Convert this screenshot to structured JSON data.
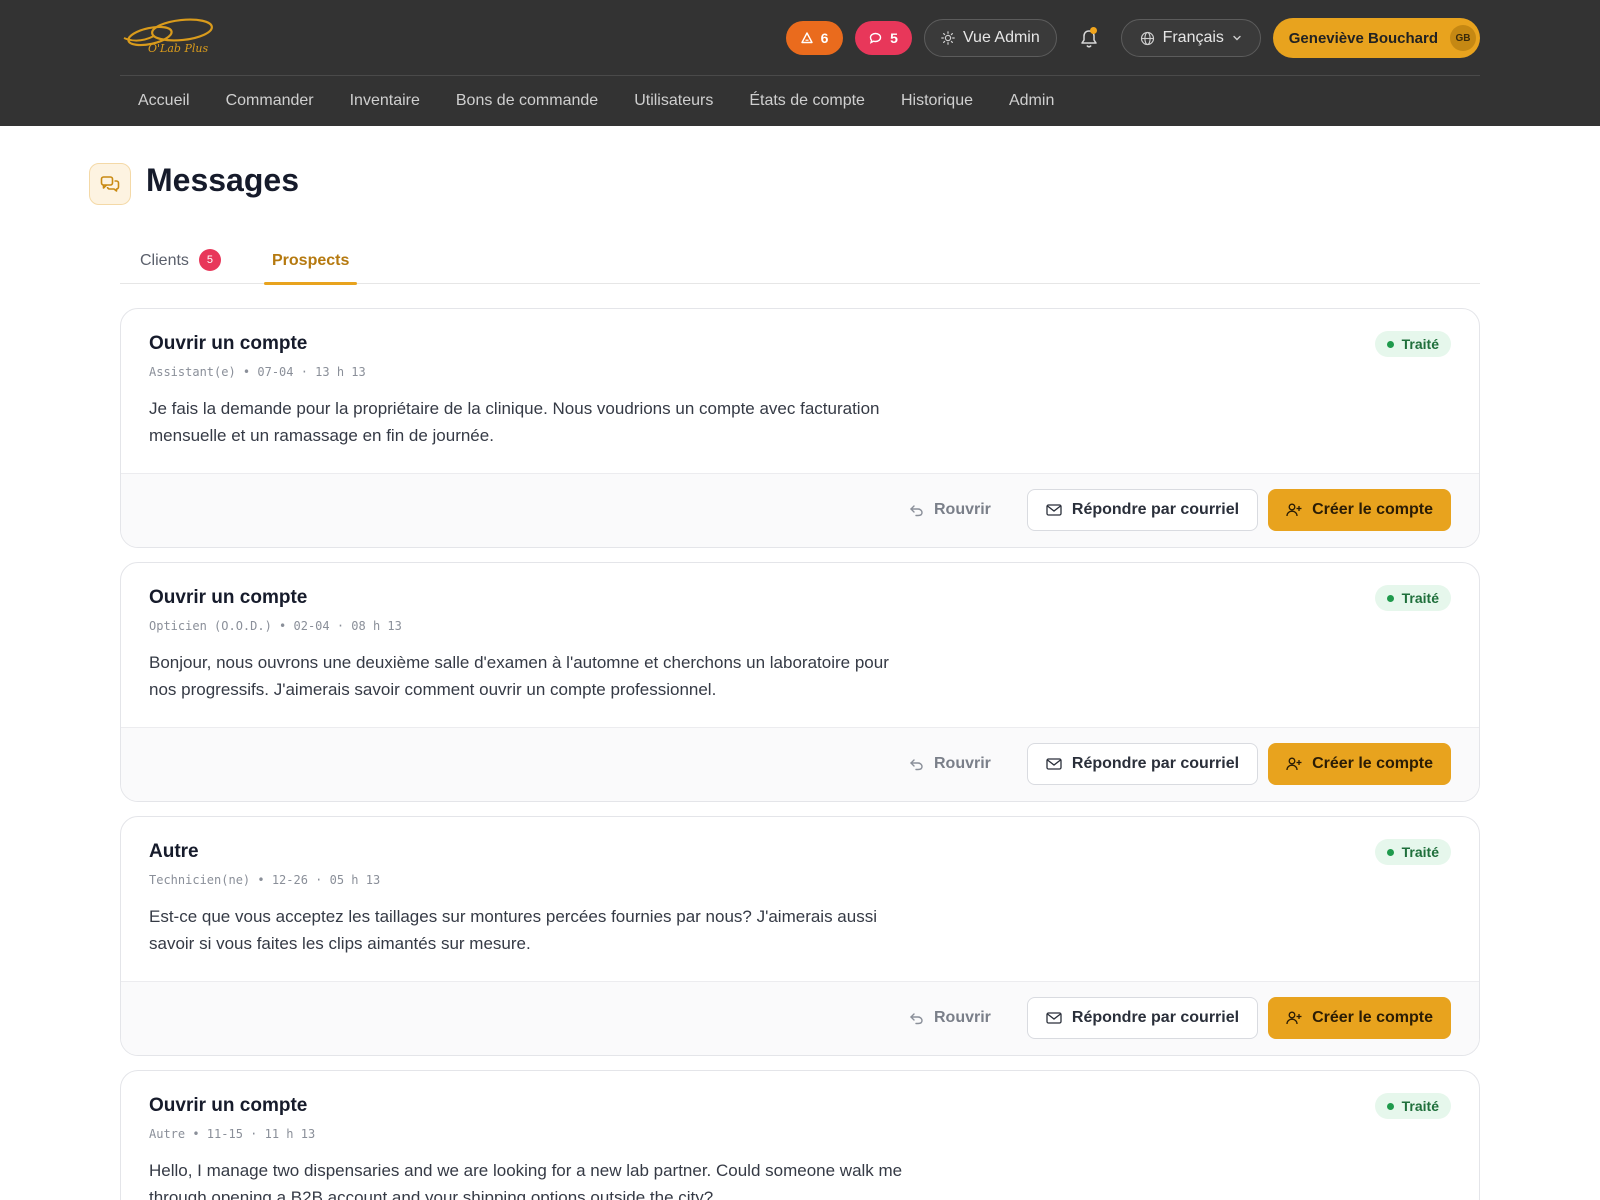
{
  "colors": {
    "header_bg": "#333333",
    "accent": "#e8a31e",
    "alert_orange": "#ea6b1d",
    "alert_red": "#e8375a",
    "status_green": "#1f9a4c"
  },
  "header": {
    "logo_text": "O'Lab Plus",
    "alerts_count": "6",
    "messages_count": "5",
    "admin_view_label": "Vue Admin",
    "language_label": "Français",
    "user_name": "Geneviève Bouchard",
    "user_initials": "GB",
    "nav": [
      "Accueil",
      "Commander",
      "Inventaire",
      "Bons de commande",
      "Utilisateurs",
      "États de compte",
      "Historique",
      "Admin"
    ]
  },
  "page": {
    "title": "Messages",
    "tabs": {
      "clients_label": "Clients",
      "clients_badge": "5",
      "prospects_label": "Prospects"
    }
  },
  "actions": {
    "reopen_label": "Rouvrir",
    "reply_label": "Répondre par courriel",
    "create_label": "Créer le compte"
  },
  "messages": [
    {
      "title": "Ouvrir un compte",
      "meta": "Assistant(e) • 07-04 · 13 h 13",
      "body": "Je fais la demande pour la propriétaire de la clinique. Nous voudrions un compte avec facturation mensuelle et un ramassage en fin de journée.",
      "status": "Traité"
    },
    {
      "title": "Ouvrir un compte",
      "meta": "Opticien (O.O.D.) • 02-04 · 08 h 13",
      "body": "Bonjour, nous ouvrons une deuxième salle d'examen à l'automne et cherchons un laboratoire pour nos progressifs. J'aimerais savoir comment ouvrir un compte professionnel.",
      "status": "Traité"
    },
    {
      "title": "Autre",
      "meta": "Technicien(ne) • 12-26 · 05 h 13",
      "body": "Est-ce que vous acceptez les taillages sur montures percées fournies par nous? J'aimerais aussi savoir si vous faites les clips aimantés sur mesure.",
      "status": "Traité"
    },
    {
      "title": "Ouvrir un compte",
      "meta": "Autre • 11-15 · 11 h 13",
      "body": "Hello, I manage two dispensaries and we are looking for a new lab partner. Could someone walk me through opening a B2B account and your shipping options outside the city?",
      "status": "Traité"
    }
  ]
}
